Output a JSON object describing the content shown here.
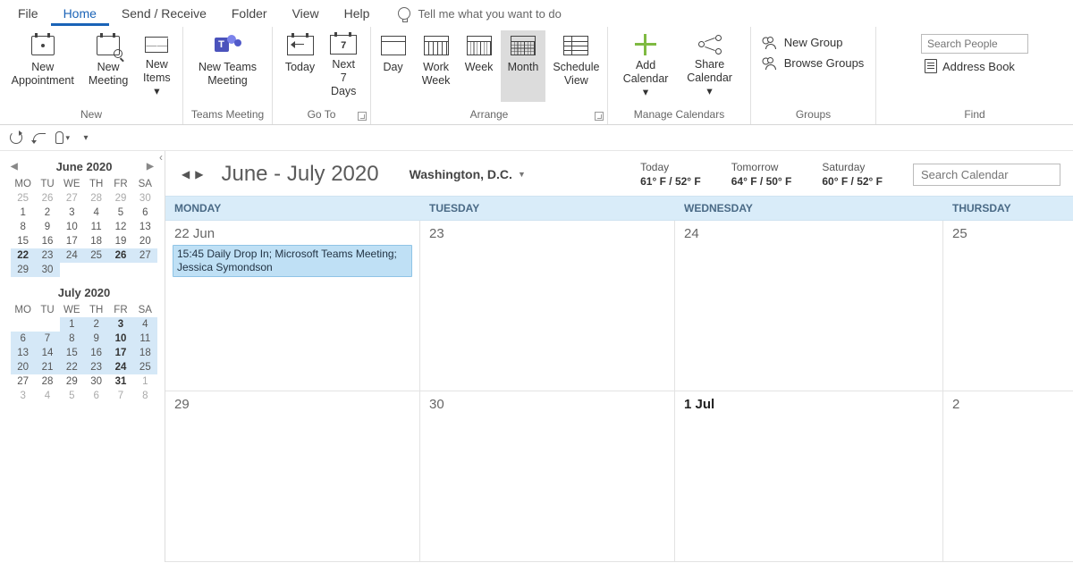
{
  "menu": {
    "file": "File",
    "home": "Home",
    "sendrecv": "Send / Receive",
    "folder": "Folder",
    "view": "View",
    "help": "Help",
    "tellme": "Tell me what you want to do"
  },
  "ribbon": {
    "new_group": "New",
    "new_appt": "New Appointment",
    "new_meet": "New Meeting",
    "new_items": "New Items",
    "teams_group": "Teams Meeting",
    "teams_btn": "New Teams Meeting",
    "goto_group": "Go To",
    "today": "Today",
    "next7": "Next 7 Days",
    "arrange_group": "Arrange",
    "day": "Day",
    "workweek": "Work Week",
    "week": "Week",
    "month": "Month",
    "schedview": "Schedule View",
    "manage_group": "Manage Calendars",
    "addcal": "Add Calendar",
    "sharecal": "Share Calendar",
    "groups_group": "Groups",
    "newgroup": "New Group",
    "browsegroups": "Browse Groups",
    "find_group": "Find",
    "search_people_placeholder": "Search People",
    "addr_book": "Address Book"
  },
  "sidebar": {
    "cal1": {
      "title": "June 2020",
      "dow": [
        "MO",
        "TU",
        "WE",
        "TH",
        "FR",
        "SA"
      ],
      "rows": [
        [
          {
            "n": "25",
            "dim": true
          },
          {
            "n": "26",
            "dim": true
          },
          {
            "n": "27",
            "dim": true
          },
          {
            "n": "28",
            "dim": true
          },
          {
            "n": "29",
            "dim": true
          },
          {
            "n": "30",
            "dim": true
          }
        ],
        [
          {
            "n": "1"
          },
          {
            "n": "2"
          },
          {
            "n": "3"
          },
          {
            "n": "4"
          },
          {
            "n": "5"
          },
          {
            "n": "6"
          }
        ],
        [
          {
            "n": "8"
          },
          {
            "n": "9"
          },
          {
            "n": "10"
          },
          {
            "n": "11"
          },
          {
            "n": "12"
          },
          {
            "n": "13"
          }
        ],
        [
          {
            "n": "15"
          },
          {
            "n": "16"
          },
          {
            "n": "17"
          },
          {
            "n": "18"
          },
          {
            "n": "19"
          },
          {
            "n": "20"
          }
        ],
        [
          {
            "n": "22",
            "hl": true,
            "bold": true
          },
          {
            "n": "23",
            "hl": true
          },
          {
            "n": "24",
            "hl": true
          },
          {
            "n": "25",
            "hl": true
          },
          {
            "n": "26",
            "hl": true,
            "bold": true
          },
          {
            "n": "27",
            "hl": true
          }
        ],
        [
          {
            "n": "29",
            "hl": true
          },
          {
            "n": "30",
            "hl": true
          },
          {
            "n": ""
          },
          {
            "n": ""
          },
          {
            "n": ""
          },
          {
            "n": ""
          }
        ]
      ]
    },
    "cal2": {
      "title": "July 2020",
      "dow": [
        "MO",
        "TU",
        "WE",
        "TH",
        "FR",
        "SA"
      ],
      "rows": [
        [
          {
            "n": ""
          },
          {
            "n": ""
          },
          {
            "n": "1",
            "hl": true
          },
          {
            "n": "2",
            "hl": true
          },
          {
            "n": "3",
            "hl": true,
            "bold": true
          },
          {
            "n": "4",
            "hl": true
          }
        ],
        [
          {
            "n": "6",
            "hl": true
          },
          {
            "n": "7",
            "hl": true
          },
          {
            "n": "8",
            "hl": true
          },
          {
            "n": "9",
            "hl": true
          },
          {
            "n": "10",
            "hl": true,
            "bold": true
          },
          {
            "n": "11",
            "hl": true
          }
        ],
        [
          {
            "n": "13",
            "hl": true
          },
          {
            "n": "14",
            "hl": true
          },
          {
            "n": "15",
            "hl": true
          },
          {
            "n": "16",
            "hl": true
          },
          {
            "n": "17",
            "hl": true,
            "bold": true
          },
          {
            "n": "18",
            "hl": true
          }
        ],
        [
          {
            "n": "20",
            "hl": true
          },
          {
            "n": "21",
            "hl": true
          },
          {
            "n": "22",
            "hl": true
          },
          {
            "n": "23",
            "hl": true
          },
          {
            "n": "24",
            "hl": true,
            "bold": true
          },
          {
            "n": "25",
            "hl": true
          }
        ],
        [
          {
            "n": "27"
          },
          {
            "n": "28"
          },
          {
            "n": "29"
          },
          {
            "n": "30"
          },
          {
            "n": "31",
            "bold": true
          },
          {
            "n": "1",
            "dim": true
          }
        ],
        [
          {
            "n": "3",
            "dim": true
          },
          {
            "n": "4",
            "dim": true
          },
          {
            "n": "5",
            "dim": true
          },
          {
            "n": "6",
            "dim": true
          },
          {
            "n": "7",
            "dim": true
          },
          {
            "n": "8",
            "dim": true
          }
        ]
      ]
    }
  },
  "calendar": {
    "range_title": "June - July 2020",
    "location": "Washington,  D.C.",
    "weather": [
      {
        "label": "Today",
        "temp": "61° F / 52° F"
      },
      {
        "label": "Tomorrow",
        "temp": "64° F / 50° F"
      },
      {
        "label": "Saturday",
        "temp": "60° F / 52° F"
      }
    ],
    "search_placeholder": "Search Calendar",
    "columns": [
      "MONDAY",
      "TUESDAY",
      "WEDNESDAY",
      "THURSDAY"
    ],
    "weeks": [
      {
        "days": [
          {
            "label": "22 Jun",
            "events": [
              {
                "text": "15:45 Daily Drop In; Microsoft Teams Meeting; Jessica Symondson"
              }
            ]
          },
          {
            "label": "23"
          },
          {
            "label": "24"
          },
          {
            "label": "25"
          }
        ]
      },
      {
        "days": [
          {
            "label": "29"
          },
          {
            "label": "30"
          },
          {
            "label": "1 Jul",
            "bold": true
          },
          {
            "label": "2"
          }
        ]
      }
    ]
  }
}
